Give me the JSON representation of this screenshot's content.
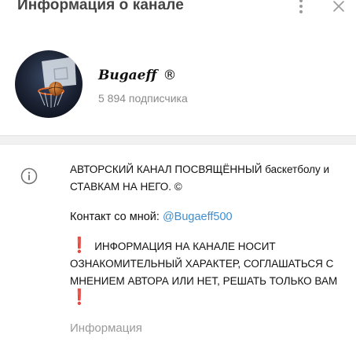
{
  "header": {
    "title": "Информация о канале",
    "more_icon": "more-vertical-icon",
    "close_icon": "close-icon"
  },
  "channel": {
    "name": "Bugaeff",
    "name_suffix": "®",
    "subscribers": "5 894 подписчика"
  },
  "about": {
    "description_lines": [
      "АВТОРСКИЙ КАНАЛ ПОСВЯЩЁННЫЙ баскетболу и",
      "СТАВКАМ НА НЕГО. ©"
    ],
    "contact_prefix": "Контакт со мной: ",
    "contact_link": "@Bugaeff500",
    "warning_mark": "❗",
    "warning_lines": [
      "ИНФОРМАЦИЯ НА КАНАЛЕ НОСИТ",
      "ОЗНАКОМИТЕЛЬНЫЙ ХАРАКТЕР, СОГЛАШАТЬСЯ С",
      "МНЕНИЕМ АВТОРА ИЛИ НЕТ, РЕШАТЬ ТОЛЬКО ВАМ"
    ],
    "label": "Информация"
  },
  "colors": {
    "link": "#3d8fd1",
    "warning": "#e0202a",
    "muted": "#8a8a8a"
  }
}
